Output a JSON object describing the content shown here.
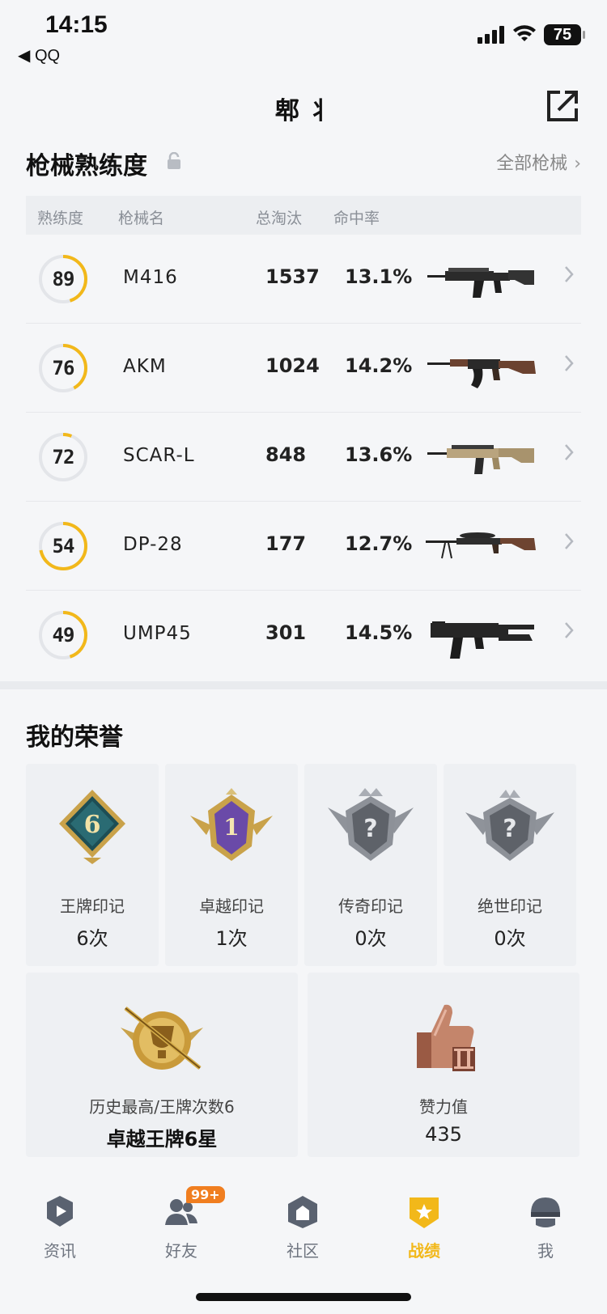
{
  "status_bar": {
    "time": "14:15",
    "back_app": "◀ QQ",
    "battery": "75"
  },
  "header": {
    "title": "郫 丬"
  },
  "weapons": {
    "section_title": "枪械熟练度",
    "all_link": "全部枪械",
    "columns": [
      "熟练度",
      "枪械名",
      "总淘汰",
      "命中率"
    ],
    "rows": [
      {
        "proficiency": "89",
        "name": "M416",
        "kills": "1537",
        "accuracy": "13.1%",
        "ring": 0.45
      },
      {
        "proficiency": "76",
        "name": "AKM",
        "kills": "1024",
        "accuracy": "14.2%",
        "ring": 0.42
      },
      {
        "proficiency": "72",
        "name": "SCAR-L",
        "kills": "848",
        "accuracy": "13.6%",
        "ring": 0.06
      },
      {
        "proficiency": "54",
        "name": "DP-28",
        "kills": "177",
        "accuracy": "12.7%",
        "ring": 0.72
      },
      {
        "proficiency": "49",
        "name": "UMP45",
        "kills": "301",
        "accuracy": "14.5%",
        "ring": 0.45
      }
    ]
  },
  "honors": {
    "section_title": "我的荣誉",
    "cards": [
      {
        "name": "王牌印记",
        "value": "6次",
        "icon": "ace-emblem-icon",
        "num": "6"
      },
      {
        "name": "卓越印记",
        "value": "1次",
        "icon": "excellence-emblem-icon",
        "num": "1"
      },
      {
        "name": "传奇印记",
        "value": "0次",
        "icon": "legend-emblem-icon",
        "num": "?"
      },
      {
        "name": "绝世印记",
        "value": "0次",
        "icon": "peerless-emblem-icon",
        "num": "?"
      }
    ],
    "big_cards": [
      {
        "name": "历史最高/王牌次数6",
        "value": "卓越王牌6星",
        "icon": "rank-trophy-icon"
      },
      {
        "name": "赞力值",
        "value": "435",
        "icon": "thumbs-up-icon"
      }
    ]
  },
  "nav": {
    "items": [
      {
        "label": "资讯",
        "icon": "news-icon"
      },
      {
        "label": "好友",
        "icon": "friends-icon",
        "badge": "99+"
      },
      {
        "label": "社区",
        "icon": "community-icon"
      },
      {
        "label": "战绩",
        "icon": "stats-icon"
      },
      {
        "label": "我",
        "icon": "profile-icon"
      }
    ],
    "active_index": 3
  },
  "colors": {
    "accent": "#f2b81a",
    "ring_track": "#e3e5e9",
    "badge": "#f07e20"
  }
}
